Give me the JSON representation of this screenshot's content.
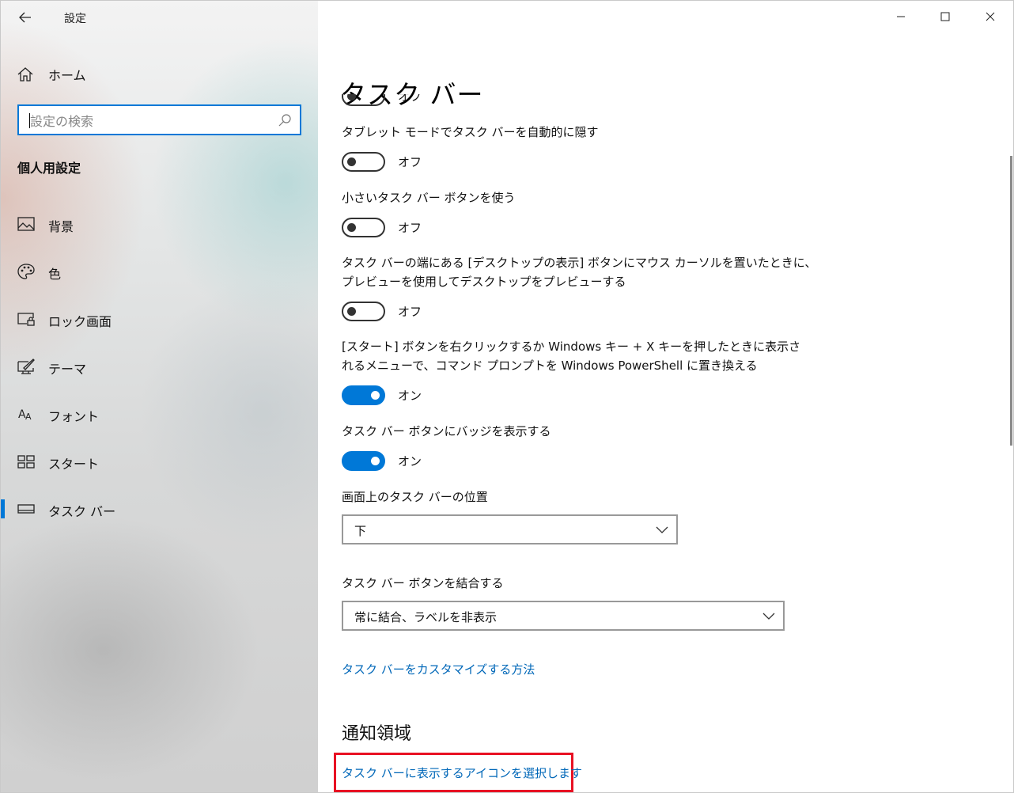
{
  "app": {
    "title": "設定"
  },
  "sidebar": {
    "home_label": "ホーム",
    "search_placeholder": "設定の検索",
    "section_title": "個人用設定",
    "items": [
      {
        "label": "背景",
        "icon": "picture-icon"
      },
      {
        "label": "色",
        "icon": "palette-icon"
      },
      {
        "label": "ロック画面",
        "icon": "lock-screen-icon"
      },
      {
        "label": "テーマ",
        "icon": "theme-icon"
      },
      {
        "label": "フォント",
        "icon": "font-icon"
      },
      {
        "label": "スタート",
        "icon": "start-icon"
      },
      {
        "label": "タスク バー",
        "icon": "taskbar-icon",
        "active": true
      }
    ]
  },
  "window_controls": [
    "minimize-icon",
    "maximize-icon",
    "close-icon"
  ],
  "page": {
    "title": "タスク バー",
    "partial_toggle_state": "オフ",
    "settings": [
      {
        "label": "タブレット モードでタスク バーを自動的に隠す",
        "state": "オフ",
        "on": false
      },
      {
        "label": "小さいタスク バー ボタンを使う",
        "state": "オフ",
        "on": false
      },
      {
        "label_line1": "タスク バーの端にある [デスクトップの表示] ボタンにマウス カーソルを置いたときに、",
        "label_line2": "プレビューを使用してデスクトップをプレビューする",
        "state": "オフ",
        "on": false
      },
      {
        "label_line1": "[スタート] ボタンを右クリックするか Windows キー + X キーを押したときに表示さ",
        "label_line2": "れるメニューで、コマンド プロンプトを Windows PowerShell に置き換える",
        "state": "オン",
        "on": true
      },
      {
        "label": "タスク バー ボタンにバッジを表示する",
        "state": "オン",
        "on": true
      }
    ],
    "position": {
      "label": "画面上のタスク バーの位置",
      "value": "下"
    },
    "combine": {
      "label": "タスク バー ボタンを結合する",
      "value": "常に結合、ラベルを非表示"
    },
    "customize_link": "タスク バーをカスタマイズする方法",
    "notification_heading": "通知領域",
    "select_icons_link": "タスク バーに表示するアイコンを選択します",
    "highlight_color": "#e81123",
    "accent_color": "#0078d7",
    "link_color": "#0067b8"
  }
}
